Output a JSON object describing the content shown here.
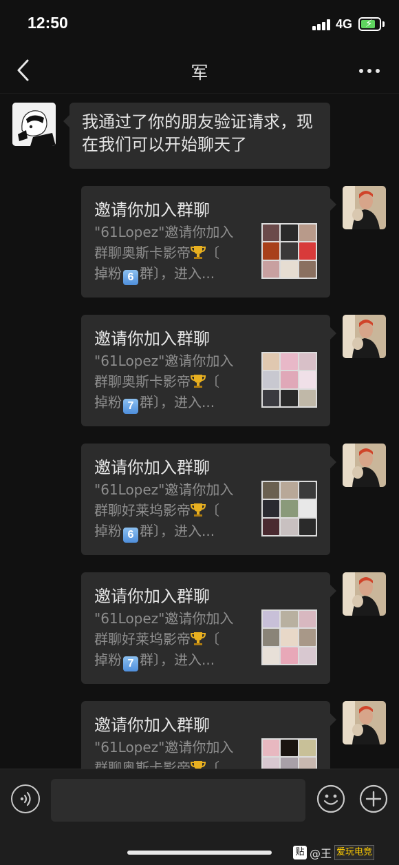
{
  "status_bar": {
    "time": "12:50",
    "network": "4G"
  },
  "header": {
    "title": "军"
  },
  "messages": {
    "system_text": "我通过了你的朋友验证请求，现在我们可以开始聊天了",
    "cards": [
      {
        "title": "邀请你加入群聊",
        "line1": "\"61Lopez\"邀请你加入",
        "line2_text": "群聊奥斯卡影帝",
        "line2_tail": "〔",
        "line3_pre": "掉粉",
        "number": "6",
        "line3_post": "群〕，进入..."
      },
      {
        "title": "邀请你加入群聊",
        "line1": "\"61Lopez\"邀请你加入",
        "line2_text": "群聊奥斯卡影帝",
        "line2_tail": "〔",
        "line3_pre": "掉粉",
        "number": "7",
        "line3_post": "群〕，进入..."
      },
      {
        "title": "邀请你加入群聊",
        "line1": "\"61Lopez\"邀请你加入",
        "line2_text": "群聊好莱坞影帝",
        "line2_tail": "〔",
        "line3_pre": "掉粉",
        "number": "6",
        "line3_post": "群〕，进入..."
      },
      {
        "title": "邀请你加入群聊",
        "line1": "\"61Lopez\"邀请你加入",
        "line2_text": "群聊好莱坞影帝",
        "line2_tail": "〔",
        "line3_pre": "掉粉",
        "number": "7",
        "line3_post": "群〕，进入..."
      },
      {
        "title": "邀请你加入群聊",
        "line1": "\"61Lopez\"邀请你加入",
        "line2_text": "群聊奥斯卡影帝",
        "line2_tail": "〔",
        "line3_pre": "",
        "number": "",
        "line3_post": ""
      }
    ]
  },
  "watermark": {
    "box": "贴",
    "text": "@王",
    "logo": "爱玩电竞"
  },
  "colors": {
    "background": "#111111",
    "bubble": "#2c2c2c",
    "keycap": "#4f8fdc",
    "trophy": "#e8b020"
  },
  "icons": [
    "back-icon",
    "more-icon",
    "trophy-icon",
    "voice-icon",
    "emoji-icon",
    "plus-icon"
  ]
}
